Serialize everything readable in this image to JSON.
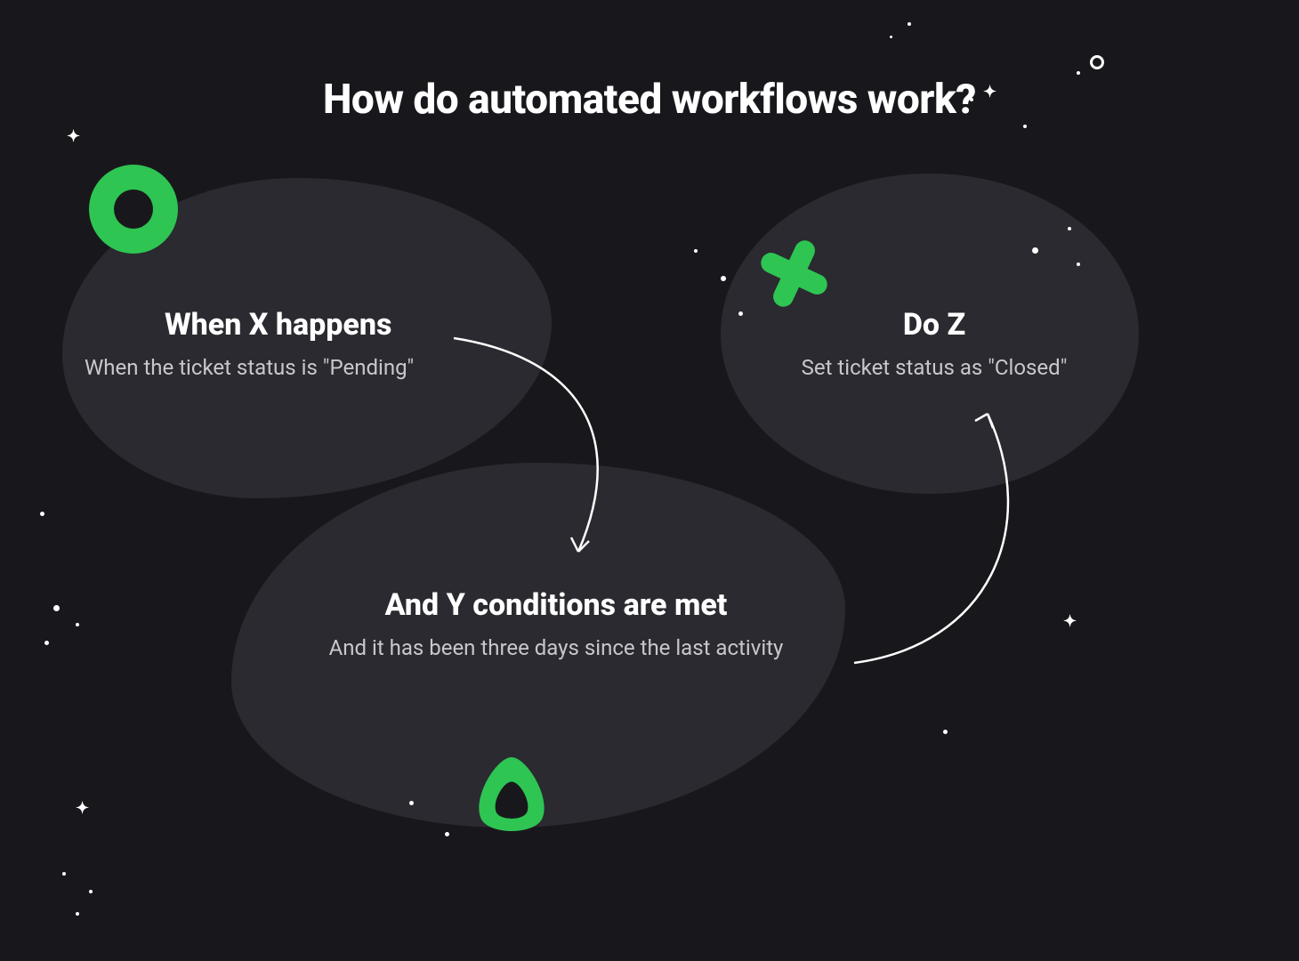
{
  "colors": {
    "background": "#18181c",
    "blob": "#2a2a30",
    "accent": "#2ec553",
    "text": "#ffffff",
    "muted": "#c8c8cc"
  },
  "header": {
    "title": "How do automated workflows work?"
  },
  "steps": {
    "trigger": {
      "title": "When X happens",
      "subtitle": "When the ticket status is \"Pending\""
    },
    "condition": {
      "title": "And Y conditions are met",
      "subtitle": "And it has been three days since the last activity"
    },
    "action": {
      "title": "Do Z",
      "subtitle": "Set ticket status as \"Closed\""
    }
  },
  "icons": {
    "ring": "ring-icon",
    "plus": "plus-icon",
    "triangle": "triangle-icon"
  },
  "flow": [
    "trigger",
    "condition",
    "action"
  ]
}
